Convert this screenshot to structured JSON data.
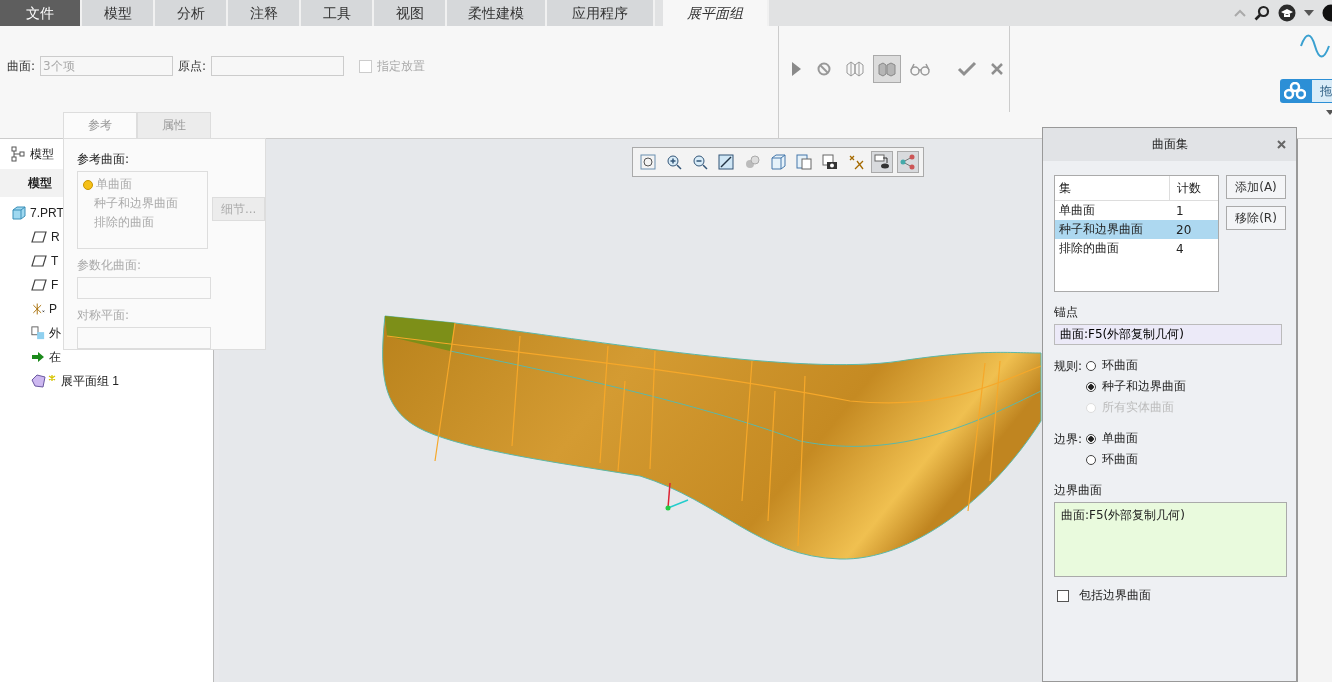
{
  "ribbon_tabs": [
    {
      "label": "文件",
      "kind": "file",
      "selected": false
    },
    {
      "label": "模型",
      "kind": "tab",
      "selected": false
    },
    {
      "label": "分析",
      "kind": "tab",
      "selected": false
    },
    {
      "label": "注释",
      "kind": "tab",
      "selected": false
    },
    {
      "label": "工具",
      "kind": "tab",
      "selected": false
    },
    {
      "label": "视图",
      "kind": "tab",
      "selected": false
    },
    {
      "label": "柔性建模",
      "kind": "tab",
      "selected": false
    },
    {
      "label": "应用程序",
      "kind": "tab",
      "selected": false
    },
    {
      "label": "展平面组",
      "kind": "tab",
      "selected": true
    }
  ],
  "ribbon": {
    "surface_label": "曲面:",
    "surface_value": "3个项",
    "origin_label": "原点:",
    "placement": {
      "label": "指定放置",
      "checked": false,
      "disabled": true
    }
  },
  "drag_widget": {
    "label": "拖"
  },
  "sub_tabs": [
    {
      "label": "参考",
      "selected": true
    },
    {
      "label": "属性",
      "selected": false
    }
  ],
  "model_tree": {
    "header": "模型",
    "subheader": "模型",
    "items": [
      {
        "label": "7.PRT",
        "kind": "part",
        "children": [
          {
            "label": "R",
            "kind": "plane"
          },
          {
            "label": "T",
            "kind": "plane"
          },
          {
            "label": "F",
            "kind": "plane"
          },
          {
            "label": "P",
            "kind": "csys"
          },
          {
            "label": "外",
            "kind": "copy"
          },
          {
            "label": "在",
            "kind": "insert"
          },
          {
            "label": "展平面组 1",
            "kind": "flatten"
          }
        ]
      }
    ]
  },
  "reference_panel": {
    "title": "参考曲面:",
    "sets": [
      {
        "label": "单曲面",
        "selected": true
      },
      {
        "label": "种子和边界曲面",
        "selected": false
      },
      {
        "label": "排除的曲面",
        "selected": false
      }
    ],
    "details_button": "细节...",
    "parametrization_label": "参数化曲面:",
    "symmetry_label": "对称平面:"
  },
  "dialog": {
    "title": "曲面集",
    "columns": [
      "集",
      "计数"
    ],
    "rows": [
      {
        "set": "单曲面",
        "count": "1",
        "selected": false
      },
      {
        "set": "种子和边界曲面",
        "count": "20",
        "selected": true
      },
      {
        "set": "排除的曲面",
        "count": "4",
        "selected": false
      }
    ],
    "buttons": [
      "添加(A)",
      "移除(R)"
    ],
    "anchor_label": "锚点",
    "anchor_value": "曲面:F5(外部复制几何)",
    "rule_label": "规则:",
    "rules": [
      {
        "label": "环曲面",
        "selected": false,
        "disabled": false
      },
      {
        "label": "种子和边界曲面",
        "selected": true,
        "disabled": false
      },
      {
        "label": "所有实体曲面",
        "selected": false,
        "disabled": true
      }
    ],
    "boundary_label": "边界:",
    "boundaries": [
      {
        "label": "单曲面",
        "selected": true
      },
      {
        "label": "环曲面",
        "selected": false
      }
    ],
    "boundary_surfaces_label": "边界曲面",
    "boundary_surfaces_value": "曲面:F5(外部复制几何)",
    "include": {
      "label": "包括边界曲面",
      "checked": false
    }
  }
}
